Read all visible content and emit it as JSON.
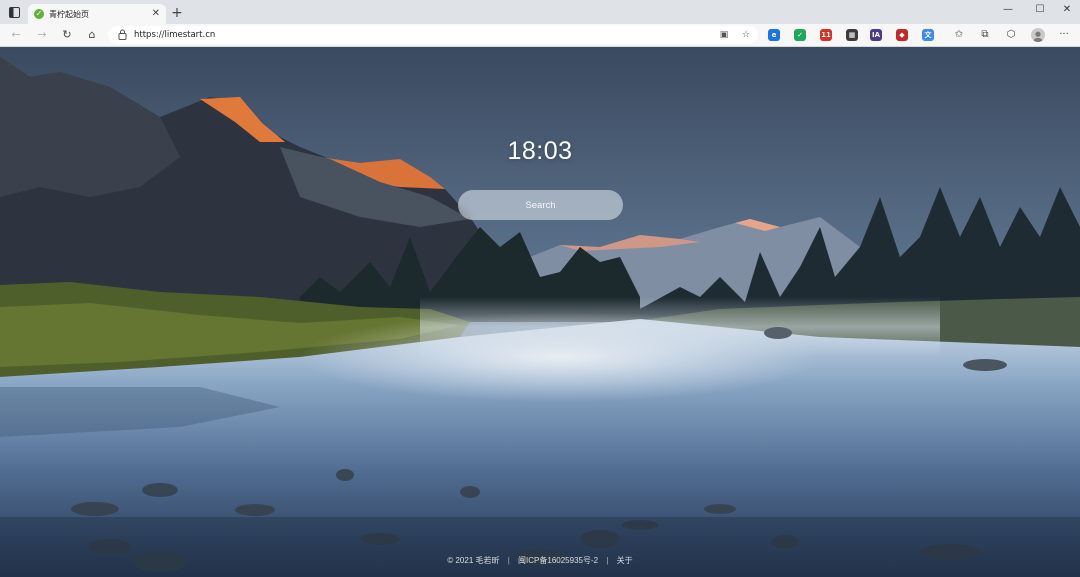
{
  "browser": {
    "tab_title": "青柠起始页",
    "tab_favicon": "lime-icon",
    "url": "https://limestart.cn",
    "close_tab": "✕",
    "new_tab": "+",
    "window_controls": {
      "minimize": "—",
      "maximize": "☐",
      "close": "✕"
    }
  },
  "toolbar": {
    "back": "←",
    "forward": "→",
    "refresh": "↻",
    "home": "⌂",
    "read_view": "▣",
    "favorite_add": "☆",
    "favorites": "✩",
    "collections": "⧉",
    "browser_essentials": "⬡",
    "more": "···"
  },
  "extensions": [
    {
      "name": "edge-extension-icon",
      "label": "e",
      "color": "#1a73e8"
    },
    {
      "name": "green-extension-icon",
      "label": "✓",
      "color": "#23a55a"
    },
    {
      "name": "red-badge-extension-icon",
      "label": "11",
      "color": "#d93025"
    },
    {
      "name": "dark-extension-icon",
      "label": "▦",
      "color": "#3c3c3c"
    },
    {
      "name": "ia-extension-icon",
      "label": "IA",
      "color": "#4b3a8c"
    },
    {
      "name": "shield-extension-icon",
      "label": "◆",
      "color": "#c62828"
    },
    {
      "name": "translate-extension-icon",
      "label": "文",
      "color": "#4285f4"
    }
  ],
  "page": {
    "clock": "18:03",
    "search_placeholder": "Search",
    "footer": {
      "copyright": "© 2021 毛若昕",
      "icp": "闽ICP备16025935号-2",
      "about": "关于"
    }
  }
}
